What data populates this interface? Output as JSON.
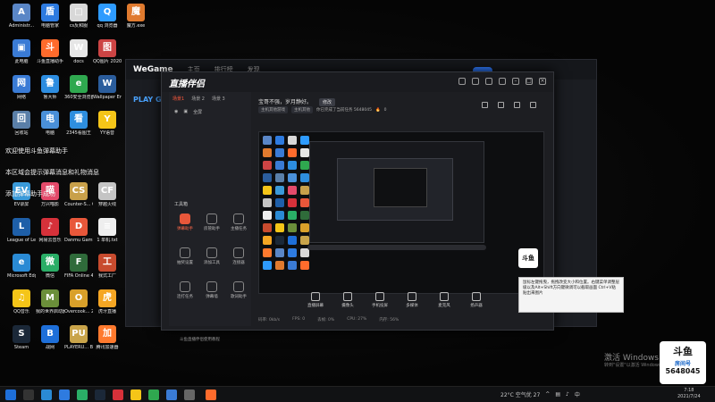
{
  "desktop_icons": [
    {
      "label": "Administr...",
      "color": "#5a86c6",
      "glyph": "A"
    },
    {
      "label": "电脑管家",
      "color": "#2e7be0",
      "glyph": "盾"
    },
    {
      "label": "cs反和服",
      "color": "#d8d8d8",
      "glyph": "□"
    },
    {
      "label": "qq 浏览器",
      "color": "#2e9bff",
      "glyph": "Q"
    },
    {
      "label": "魔方.exe",
      "color": "#e07a2e",
      "glyph": "魔"
    },
    {
      "label": "此电脑",
      "color": "#3a7bd5",
      "glyph": "▣"
    },
    {
      "label": "斗鱼直播助手",
      "color": "#ff6b2c",
      "glyph": "斗"
    },
    {
      "label": "docs",
      "color": "#e6e6e6",
      "glyph": "W"
    },
    {
      "label": "QQ图片 20201128...",
      "color": "#cc4444",
      "glyph": "图"
    },
    {
      "label": "网络",
      "color": "#3a7bd5",
      "glyph": "网"
    },
    {
      "label": "鲁大师",
      "color": "#2d8de0",
      "glyph": "鲁"
    },
    {
      "label": "360安全浏览器",
      "color": "#2fa84f",
      "glyph": "e"
    },
    {
      "label": "Wallpaper Engine...",
      "color": "#2b5d9c",
      "glyph": "W"
    },
    {
      "label": "回收站",
      "color": "#5a7fa8",
      "glyph": "回"
    },
    {
      "label": "电脑",
      "color": "#4a90d9",
      "glyph": "电"
    },
    {
      "label": "2345看图王",
      "color": "#2e8ede",
      "glyph": "看"
    },
    {
      "label": "YY语音",
      "color": "#f5c518",
      "glyph": "Y"
    },
    {
      "label": "EV录屏",
      "color": "#3a9ad9",
      "glyph": "EV"
    },
    {
      "label": "万兴喵影",
      "color": "#e34a6a",
      "glyph": "喵"
    },
    {
      "label": "Counter-S... Global Of...",
      "color": "#c8a04a",
      "glyph": "CS"
    },
    {
      "label": "穿越火线",
      "color": "#c4c4c4",
      "glyph": "CF"
    },
    {
      "label": "League of Legends",
      "color": "#1e5fa8",
      "glyph": "L"
    },
    {
      "label": "网易云音乐",
      "color": "#d6313a",
      "glyph": "♪"
    },
    {
      "label": "Danmu Gamin...",
      "color": "#e8573a",
      "glyph": "D"
    },
    {
      "label": "1 单机.txt",
      "color": "#eeeeee",
      "glyph": "≡"
    },
    {
      "label": "Microsoft Edge",
      "color": "#2a8ad4",
      "glyph": "e"
    },
    {
      "label": "微信",
      "color": "#2aae67",
      "glyph": "微"
    },
    {
      "label": "FIFA Online 4",
      "color": "#2f6b3a",
      "glyph": "F"
    },
    {
      "label": "我式工厂",
      "color": "#c84b2e",
      "glyph": "工"
    },
    {
      "label": "QQ音乐",
      "color": "#f5c518",
      "glyph": "♫"
    },
    {
      "label": "我的世界启动器",
      "color": "#6b8f3a",
      "glyph": "M"
    },
    {
      "label": "Overcook... 2",
      "color": "#d9a02a",
      "glyph": "O"
    },
    {
      "label": "虎牙直播",
      "color": "#f5a623",
      "glyph": "虎"
    },
    {
      "label": "Steam",
      "color": "#1b2838",
      "glyph": "S"
    },
    {
      "label": "战网",
      "color": "#1e6fd9",
      "glyph": "B"
    },
    {
      "label": "PLAYERU... BATTLEGR...",
      "color": "#c9a44a",
      "glyph": "PU"
    },
    {
      "label": "腾讯加速器",
      "color": "#ff7a2e",
      "glyph": "加"
    }
  ],
  "notices": [
    "欢迎使用斗鱼弹幕助手",
    "本区域会提示弹幕消息和礼物消息",
    "添加弹幕助手成功"
  ],
  "back_window": {
    "tabs": [
      "主页",
      "排行榜",
      "发现"
    ],
    "play_label": "PLAY G"
  },
  "front_window": {
    "brand": "直播伴侣",
    "scene_tabs": [
      "场景1",
      "场景 2",
      "场景 3"
    ],
    "scene_items": [
      "全屏"
    ],
    "tools_label": "工具箱",
    "tools": [
      {
        "label": "弹幕助手",
        "hot": true
      },
      {
        "label": "房管助手",
        "hot": false
      },
      {
        "label": "主播任务",
        "hot": false
      },
      {
        "label": "抽奖设置",
        "hot": false
      },
      {
        "label": "添加工具",
        "hot": false
      },
      {
        "label": "连接器",
        "hot": false
      },
      {
        "label": "连打任务",
        "hot": false
      },
      {
        "label": "弹幕墙",
        "hot": false
      },
      {
        "label": "歌词助手",
        "hot": false
      }
    ],
    "info_text": "宝哥不强，岁月静好。",
    "info_button": "修改",
    "tags": [
      "主机其他游戏",
      "主机其他"
    ],
    "tag_note": "你已完成了当前任务 5648045",
    "fans": "0",
    "bottom_tools": [
      "直播屏幕",
      "摄像头",
      "手机投屏",
      "多媒体",
      "麦克风",
      "扬声器"
    ],
    "status_items": [
      "码率: 0kb/s",
      "FPS: 0",
      "丢帧: 0%",
      "CPU: 27%",
      "内存: 56%"
    ],
    "left_footer": "斗鱼直播伴侣使用教程",
    "tooltip": "鼠标左键拖曳，拖拽改变大小和位置。右键菜单调整层级以及Alt+Shift方向键微调可以截取画面 Ctrl+V粘贴出来图片"
  },
  "watermark": {
    "title": "激活 Windows",
    "sub": "转到\"设置\"以激活 Windows。"
  },
  "stream_badge": {
    "title": "斗鱼",
    "sub": "房间号",
    "room": "5648045"
  },
  "taskbar": {
    "weather": "22°C 空气优 27",
    "time": "7:18",
    "date": "2021/7/24",
    "ime": "中"
  }
}
